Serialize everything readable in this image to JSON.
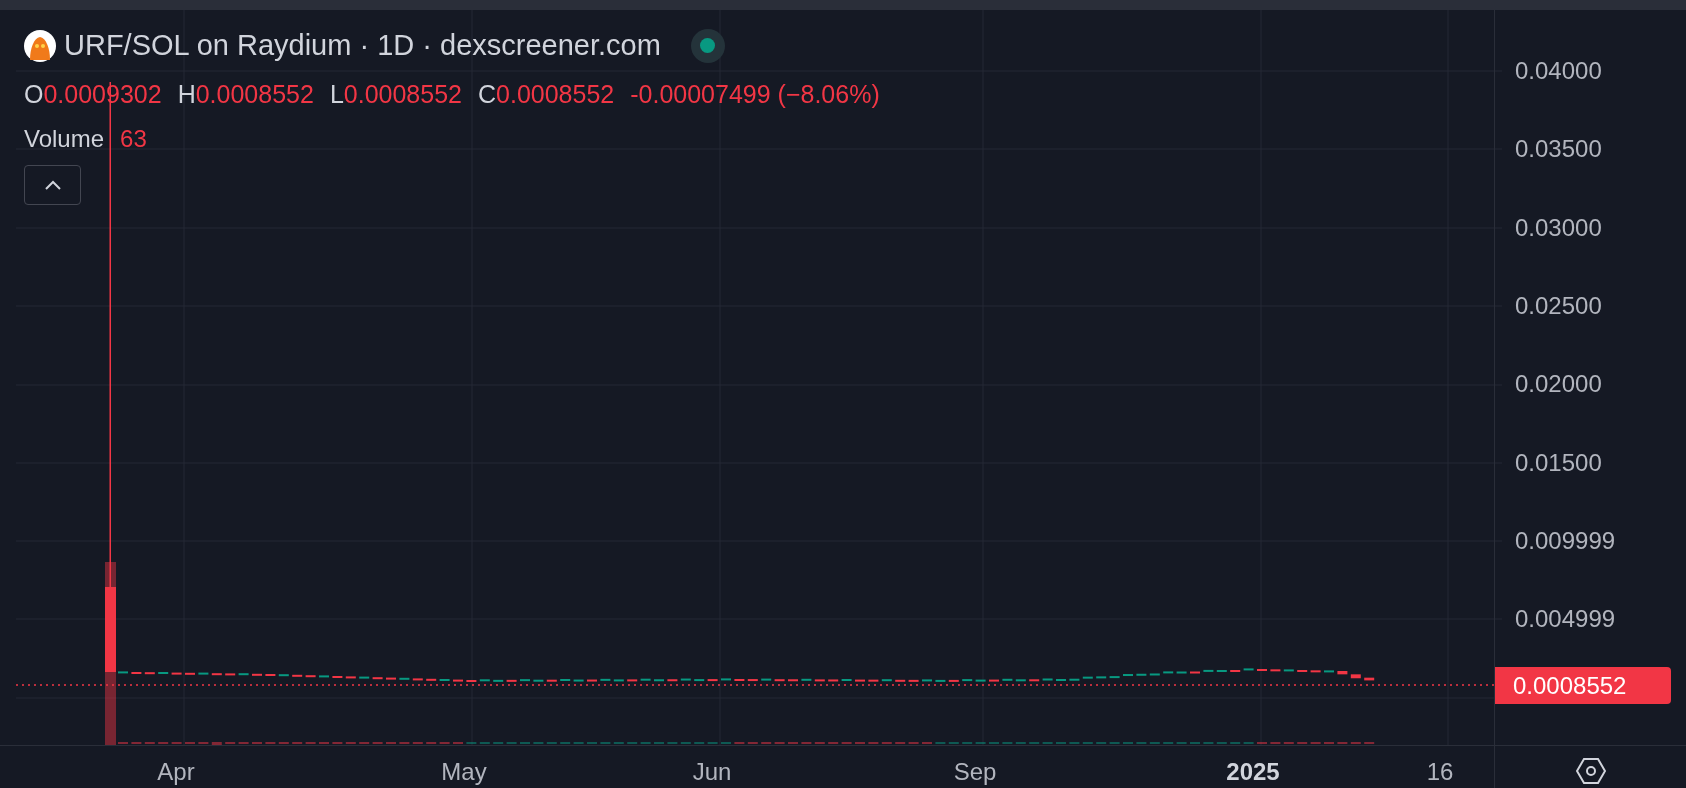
{
  "header": {
    "title": "URF/SOL on Raydium · 1D · dexscreener.com",
    "live": true
  },
  "ohlc": [
    {
      "label": "O",
      "value": "0.0009302"
    },
    {
      "label": "H",
      "value": "0.0008552"
    },
    {
      "label": "L",
      "value": "0.0008552"
    },
    {
      "label": "C",
      "value": "0.0008552"
    }
  ],
  "change": "-0.00007499 (−8.06%)",
  "volume": {
    "label": "Volume",
    "value": "63"
  },
  "price_axis": {
    "ticks": [
      "0.04000",
      "0.03500",
      "0.03000",
      "0.02500",
      "0.02000",
      "0.01500",
      "0.009999",
      "0.004999"
    ],
    "last_price": "0.0008552"
  },
  "time_axis": {
    "labels": [
      {
        "text": "Apr",
        "major": false
      },
      {
        "text": "May",
        "major": false
      },
      {
        "text": "Jun",
        "major": false
      },
      {
        "text": "Sep",
        "major": false
      },
      {
        "text": "2025",
        "major": true
      },
      {
        "text": "16",
        "major": false
      }
    ]
  }
}
